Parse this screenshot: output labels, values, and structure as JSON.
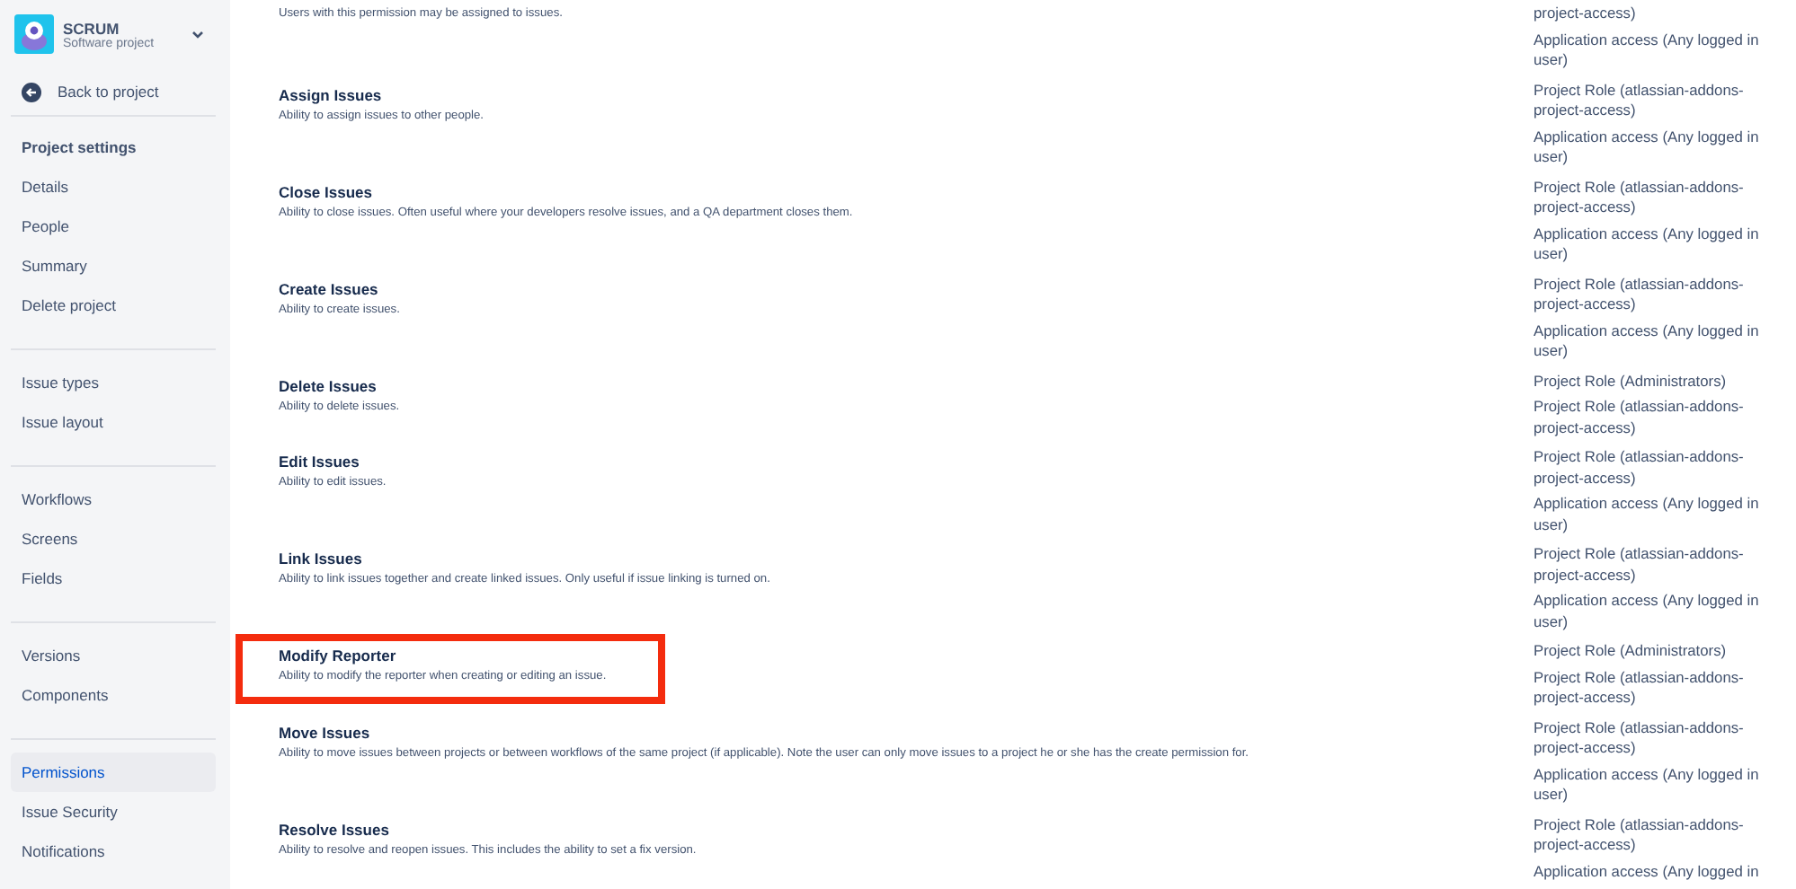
{
  "sidebar": {
    "project": {
      "name": "SCRUM",
      "type": "Software project"
    },
    "back_link": "Back to project",
    "heading": "Project settings",
    "groups": [
      [
        {
          "label": "Details",
          "selected": false
        },
        {
          "label": "People",
          "selected": false
        },
        {
          "label": "Summary",
          "selected": false
        },
        {
          "label": "Delete project",
          "selected": false
        }
      ],
      [
        {
          "label": "Issue types",
          "selected": false
        },
        {
          "label": "Issue layout",
          "selected": false
        }
      ],
      [
        {
          "label": "Workflows",
          "selected": false
        },
        {
          "label": "Screens",
          "selected": false
        },
        {
          "label": "Fields",
          "selected": false
        }
      ],
      [
        {
          "label": "Versions",
          "selected": false
        },
        {
          "label": "Components",
          "selected": false
        }
      ],
      [
        {
          "label": "Permissions",
          "selected": true
        },
        {
          "label": "Issue Security",
          "selected": false
        },
        {
          "label": "Notifications",
          "selected": false
        }
      ]
    ]
  },
  "permissions": [
    {
      "description": "Users with this permission may be assigned to issues.",
      "grants": [
        "project-access)",
        "Application access (Any logged in user)"
      ],
      "highlighted": false
    },
    {
      "title": "Assign Issues",
      "description": "Ability to assign issues to other people.",
      "grants": [
        "Project Role (atlassian-addons-project-access)",
        "Application access (Any logged in user)"
      ],
      "highlighted": false
    },
    {
      "title": "Close Issues",
      "description": "Ability to close issues. Often useful where your developers resolve issues, and a QA department closes them.",
      "grants": [
        "Project Role (atlassian-addons-project-access)",
        "Application access (Any logged in user)"
      ],
      "highlighted": false
    },
    {
      "title": "Create Issues",
      "description": "Ability to create issues.",
      "grants": [
        "Project Role (atlassian-addons-project-access)",
        "Application access (Any logged in user)"
      ],
      "highlighted": false
    },
    {
      "title": "Delete Issues",
      "description": "Ability to delete issues.",
      "grants": [
        "Project Role (Administrators)",
        "Project Role (atlassian-addons-project-access)"
      ],
      "highlighted": false
    },
    {
      "title": "Edit Issues",
      "description": "Ability to edit issues.",
      "grants": [
        "Project Role (atlassian-addons-project-access)",
        "Application access (Any logged in user)"
      ],
      "highlighted": false
    },
    {
      "title": "Link Issues",
      "description": "Ability to link issues together and create linked issues. Only useful if issue linking is turned on.",
      "grants": [
        "Project Role (atlassian-addons-project-access)",
        "Application access (Any logged in user)"
      ],
      "highlighted": false
    },
    {
      "title": "Modify Reporter",
      "description": "Ability to modify the reporter when creating or editing an issue.",
      "grants": [
        "Project Role (Administrators)",
        "Project Role (atlassian-addons-project-access)"
      ],
      "highlighted": true
    },
    {
      "title": "Move Issues",
      "description": "Ability to move issues between projects or between workflows of the same project (if applicable). Note the user can only move issues to a project he or she has the create permission for.",
      "grants": [
        "Project Role (atlassian-addons-project-access)",
        "Application access (Any logged in user)"
      ],
      "highlighted": false
    },
    {
      "title": "Resolve Issues",
      "description": "Ability to resolve and reopen issues. This includes the ability to set a fix version.",
      "grants": [
        "Project Role (atlassian-addons-project-access)",
        "Application access (Any logged in"
      ],
      "highlighted": false
    }
  ]
}
